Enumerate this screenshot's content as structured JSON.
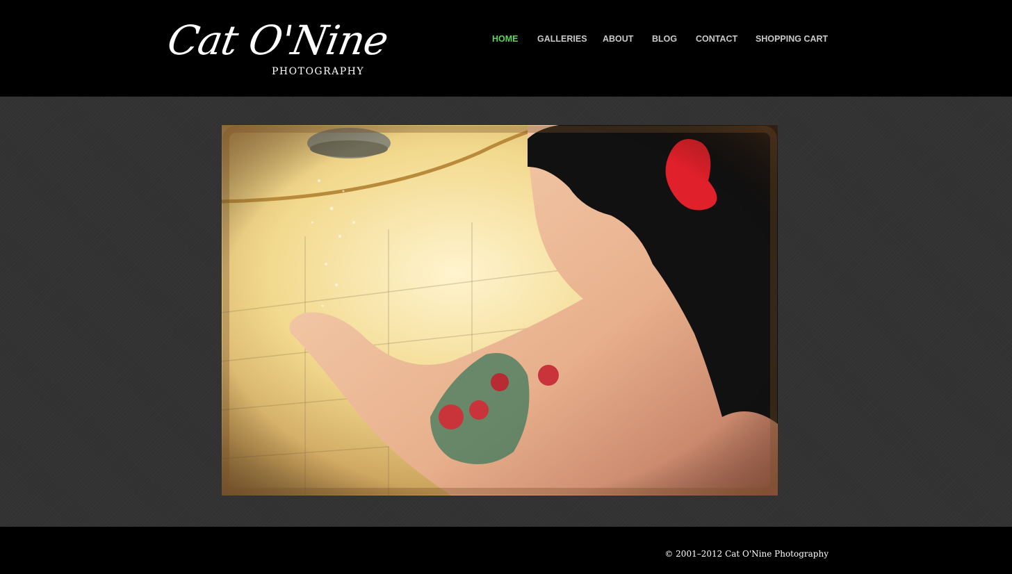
{
  "brand": {
    "name": "Cat O'Nine",
    "tagline": "PHOTOGRAPHY"
  },
  "nav": {
    "items": [
      {
        "label": "HOME",
        "active": true
      },
      {
        "label": "GALLERIES",
        "active": false
      },
      {
        "label": "ABOUT",
        "active": false
      },
      {
        "label": "BLOG",
        "active": false
      },
      {
        "label": "CONTACT",
        "active": false
      },
      {
        "label": "SHOPPING CART",
        "active": false
      }
    ]
  },
  "footer": {
    "copyright": "© 2001–2012 Cat O'Nine Photography"
  },
  "colors": {
    "accent": "#5fd15f",
    "nav_text": "#c9c9c9",
    "header_bg": "#000000",
    "body_bg": "#323232"
  }
}
